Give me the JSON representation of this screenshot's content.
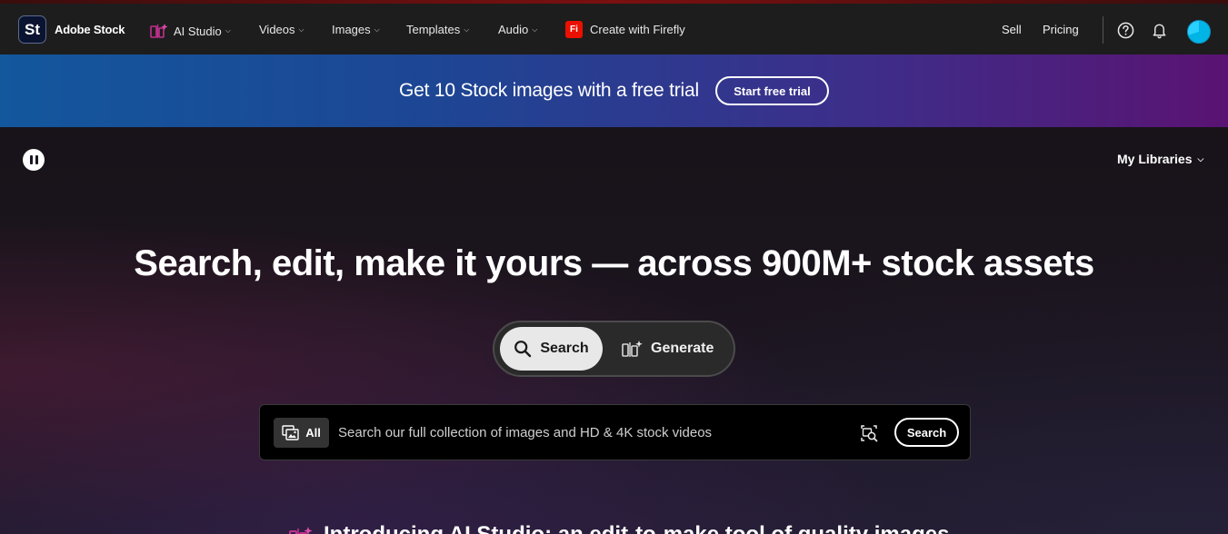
{
  "nav": {
    "brand_logo": "St",
    "brand_name": "Adobe Stock",
    "items": [
      {
        "label": "AI Studio",
        "icon": "ai-studio-icon"
      },
      {
        "label": "Videos"
      },
      {
        "label": "Images"
      },
      {
        "label": "Templates"
      },
      {
        "label": "Audio"
      }
    ],
    "firefly": {
      "logo": "Fi",
      "label": "Create with Firefly"
    },
    "sell_label": "Sell",
    "pricing_label": "Pricing",
    "icons": [
      "help-icon",
      "bell-icon",
      "avatar"
    ]
  },
  "promo": {
    "text": "Get 10 Stock images with a free trial",
    "button_label": "Start free trial"
  },
  "hero": {
    "my_libraries_label": "My Libraries",
    "headline": "Search, edit, make it yours — across 900M+ stock assets",
    "toggle": {
      "search_label": "Search",
      "generate_label": "Generate"
    },
    "searchbar": {
      "filter_label": "All",
      "placeholder": "Search our full collection of images and HD & 4K stock videos",
      "submit_label": "Search"
    },
    "intro_text": "Introducing AI Studio: an edit-to-make tool of quality images"
  },
  "colors": {
    "nav_bg": "#1d1d1d",
    "promo_gradient": [
      "#13579d",
      "#5a1372"
    ],
    "firefly_red": "#eb1000",
    "ai_studio_accent": "#c2308f",
    "avatar_blue": "#00b4e6"
  }
}
